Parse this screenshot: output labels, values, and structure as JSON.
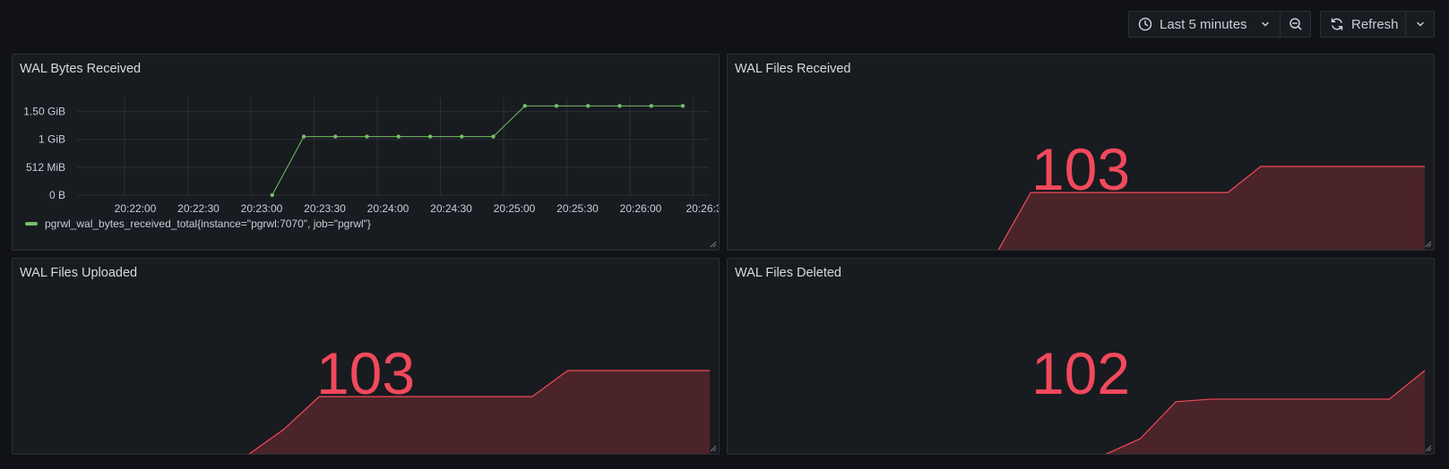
{
  "toolbar": {
    "time_range_label": "Last 5 minutes",
    "refresh_label": "Refresh",
    "icons": [
      "clock-icon",
      "chevron-down-icon",
      "zoom-out-icon",
      "refresh-icon",
      "chevron-down-icon"
    ]
  },
  "colors": {
    "background": "#111217",
    "panel": "#181b1f",
    "series_green": "#73bf69",
    "stat_red": "#f2495c",
    "stat_fill": "#4a2429"
  },
  "panels": {
    "bytes": {
      "title": "WAL Bytes Received",
      "legend": "pgrwl_wal_bytes_received_total{instance=\"pgrwl:7070\", job=\"pgrwl\"}",
      "y_ticks": [
        "1.50 GiB",
        "1 GiB",
        "512 MiB",
        "0 B"
      ],
      "x_ticks": [
        "20:22:00",
        "20:22:30",
        "20:23:00",
        "20:23:30",
        "20:24:00",
        "20:24:30",
        "20:25:00",
        "20:25:30",
        "20:26:00",
        "20:26:3"
      ]
    },
    "files_received": {
      "title": "WAL Files Received",
      "value": "103",
      "spark": [
        0,
        0,
        0.69,
        0.69,
        0.69,
        0.69,
        0.69,
        0.69,
        0.69,
        1,
        1,
        1,
        1,
        1,
        1
      ]
    },
    "files_uploaded": {
      "title": "WAL Files Uploaded",
      "value": "103",
      "spark": [
        0,
        0.3,
        0.69,
        0.69,
        0.69,
        0.69,
        0.69,
        0.69,
        0.69,
        1,
        1,
        1,
        1,
        1
      ]
    },
    "files_deleted": {
      "title": "WAL Files Deleted",
      "value": "102",
      "spark": [
        0,
        0,
        0,
        0,
        0,
        0.19,
        0.63,
        0.66,
        0.66,
        0.66,
        0.66,
        0.66,
        0.66,
        1
      ]
    }
  },
  "chart_data": {
    "type": "line",
    "title": "WAL Bytes Received",
    "xlabel": "",
    "ylabel": "",
    "x": [
      "20:23:05",
      "20:23:20",
      "20:23:35",
      "20:23:50",
      "20:24:05",
      "20:24:20",
      "20:24:35",
      "20:24:50",
      "20:25:05",
      "20:25:20",
      "20:25:35",
      "20:25:50",
      "20:26:05",
      "20:26:20"
    ],
    "series": [
      {
        "name": "pgrwl_wal_bytes_received_total{instance=\"pgrwl:7070\", job=\"pgrwl\"}",
        "unit": "GiB",
        "values": [
          0,
          1.05,
          1.05,
          1.05,
          1.05,
          1.05,
          1.05,
          1.05,
          1.6,
          1.6,
          1.6,
          1.6,
          1.6,
          1.6
        ]
      }
    ],
    "y_ticks": [
      "0 B",
      "512 MiB",
      "1 GiB",
      "1.50 GiB"
    ],
    "ylim_gib": [
      0,
      1.75
    ],
    "grid": true,
    "legend": "bottom-left"
  }
}
